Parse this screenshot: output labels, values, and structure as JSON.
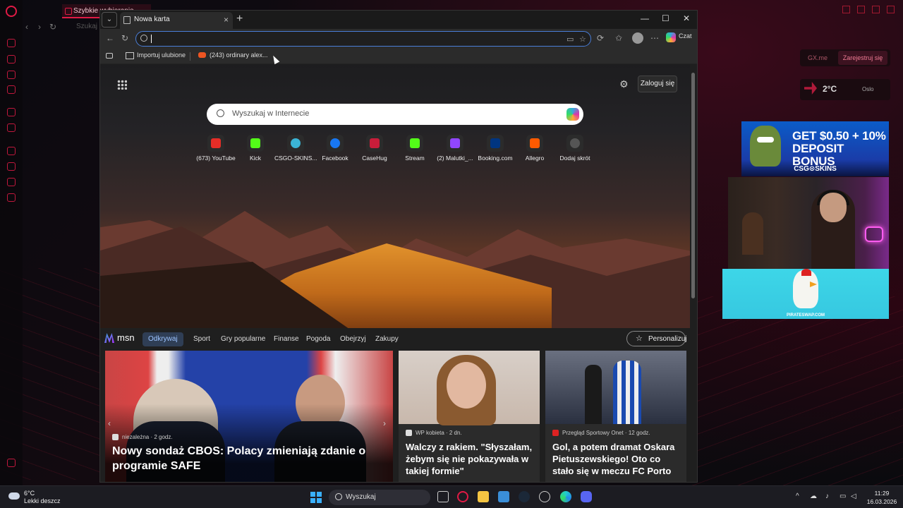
{
  "gx": {
    "tab_label": "Szybkie wybieranie",
    "address_placeholder": "Szukaj",
    "gxme_label": "GX.me",
    "register_label": "Zarejestruj się",
    "weather_temp": "2°C",
    "weather_city": "Oslo"
  },
  "overlays": {
    "csg_ad_text": "GET $0.50 + 10% DEPOSIT BONUS",
    "csg_brand": "CSG⊙SKINS",
    "pirate_label": "PIRATESWAP.COM"
  },
  "edge": {
    "tab_title": "Nowa karta",
    "tab_close": "×",
    "new_tab": "+",
    "minimize": "—",
    "maximize": "☐",
    "close": "✕",
    "address_value": "",
    "copilot_label": "Czat",
    "bookmarks": [
      {
        "label": "Importuj ulubione"
      },
      {
        "label": "(243) ordinary alex..."
      }
    ]
  },
  "ntp": {
    "signin_label": "Zaloguj się",
    "search_placeholder": "Wyszukaj w Internecie",
    "quicklinks": [
      {
        "label": "(673) YouTube",
        "color": "#e52d27"
      },
      {
        "label": "Kick",
        "color": "#53fc18"
      },
      {
        "label": "CSGO-SKINS...",
        "color": "#3bb4d6"
      },
      {
        "label": "Facebook",
        "color": "#1877f2"
      },
      {
        "label": "CaseHug",
        "color": "#c81d3a"
      },
      {
        "label": "Stream",
        "color": "#53fc18"
      },
      {
        "label": "(2) Malutki_...",
        "color": "#9146ff"
      },
      {
        "label": "Booking.com",
        "color": "#003580"
      },
      {
        "label": "Allegro",
        "color": "#ff5a00"
      },
      {
        "label": "Dodaj skrót",
        "color": "#555555"
      }
    ]
  },
  "msn": {
    "logo": "msn",
    "tabs": [
      "Odkrywaj",
      "Sport",
      "Gry popularne",
      "Finanse",
      "Pogoda",
      "Obejrzyj",
      "Zakupy"
    ],
    "personalize_label": "Personalizuj",
    "cards": [
      {
        "source": "niezależna · 2 godz.",
        "title": "Nowy sondaż CBOS: Polacy zmieniają zdanie o programie SAFE"
      },
      {
        "source": "WP kobieta · 2 dn.",
        "title": "Walczy z rakiem. \"Słyszałam, żebym się nie pokazywała w takiej formie\""
      },
      {
        "source": "Przegląd Sportowy Onet · 12 godz.",
        "title": "Gol, a potem dramat Oskara Pietuszewskiego! Oto co stało się w meczu FC Porto"
      }
    ]
  },
  "taskbar": {
    "weather_temp": "6°C",
    "weather_desc": "Lekki deszcz",
    "search_label": "Wyszukaj",
    "time": "11:29",
    "date": "16.03.2026"
  }
}
